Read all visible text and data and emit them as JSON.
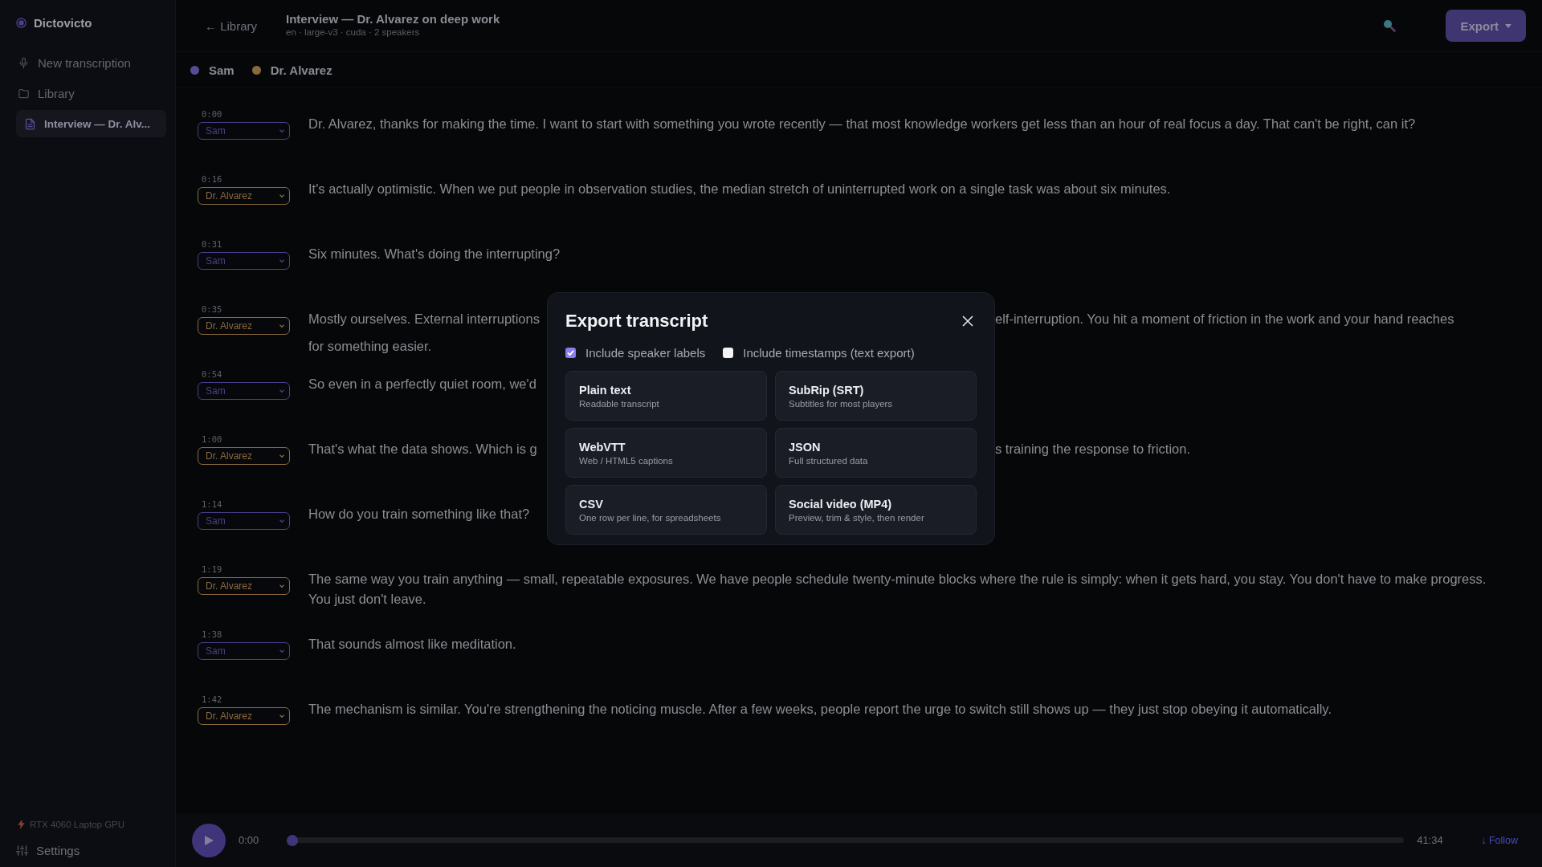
{
  "app": {
    "name": "Dictovicto"
  },
  "sidebar": {
    "items": [
      {
        "kind": "new",
        "label": "New transcription",
        "selected": false
      },
      {
        "kind": "library",
        "label": "Library",
        "selected": false
      },
      {
        "kind": "document",
        "label": "Interview — Dr. Alv...",
        "selected": true
      }
    ],
    "gpu": "RTX 4060 Laptop GPU",
    "settings": "Settings"
  },
  "header": {
    "back": "← Library",
    "title": "Interview — Dr. Alvarez on deep work",
    "meta": "en · large-v3 · cuda · 2 speakers",
    "export": "Export"
  },
  "speakers": [
    {
      "name": "Sam",
      "color": "#574b94"
    },
    {
      "name": "Dr. Alvarez",
      "color": "#8a6a3c"
    }
  ],
  "rows": [
    {
      "kind": "full",
      "time": "0:00",
      "speaker": "Sam",
      "color": "#4a3f8c",
      "text": "Dr. Alvarez, thanks for making the time. I want to start with something you wrote recently — that most knowledge workers get less than an hour of real focus a day. That can't be right, can it?"
    },
    {
      "kind": "full",
      "time": "0:16",
      "speaker": "Dr. Alvarez",
      "color": "#8a6a3c",
      "text": "It's actually optimistic. When we put people in observation studies, the median stretch of uninterrupted work on a single task was about six minutes."
    },
    {
      "kind": "full",
      "time": "0:31",
      "speaker": "Sam",
      "color": "#4a3f8c",
      "text": "Six minutes. What's doing the interrupting?"
    },
    {
      "kind": "covered",
      "time": "0:35",
      "speaker": "Dr. Alvarez",
      "color": "#8a6a3c",
      "left": "Mostly ourselves. External interruptions",
      "right": "elf-interruption. You hit a moment of friction in the work and your hand reaches",
      "more": "for something easier."
    },
    {
      "kind": "covered",
      "time": "0:54",
      "speaker": "Sam",
      "color": "#4a3f8c",
      "left": "So even in a perfectly quiet room, we'd"
    },
    {
      "kind": "covered",
      "time": "1:00",
      "speaker": "Dr. Alvarez",
      "color": "#8a6a3c",
      "left": "That's what the data shows. Which is g",
      "right": "s training the response to friction."
    },
    {
      "kind": "full",
      "time": "1:14",
      "speaker": "Sam",
      "color": "#4a3f8c",
      "text": "How do you train something like that?"
    },
    {
      "kind": "full",
      "time": "1:19",
      "speaker": "Dr. Alvarez",
      "color": "#8a6a3c",
      "text": "The same way you train anything — small, repeatable exposures. We have people schedule twenty-minute blocks where the rule is simply: when it gets hard, you stay. You don't have to make progress. You just don't leave."
    },
    {
      "kind": "full",
      "time": "1:38",
      "speaker": "Sam",
      "color": "#4a3f8c",
      "text": "That sounds almost like meditation."
    },
    {
      "kind": "full",
      "time": "1:42",
      "speaker": "Dr. Alvarez",
      "color": "#8a6a3c",
      "text": "The mechanism is similar. You're strengthening the noticing muscle. After a few weeks, people report the urge to switch still shows up — they just stop obeying it automatically."
    }
  ],
  "player": {
    "elapsed": "0:00",
    "level": 0,
    "duration": "41:34",
    "follow": "↓ Follow"
  },
  "dialog": {
    "title": "Export transcript",
    "options": [
      {
        "label": "Include speaker labels",
        "checked": true
      },
      {
        "label": "Include timestamps (text export)",
        "checked": false
      }
    ],
    "formats": [
      {
        "title": "Plain text",
        "description": "Readable transcript"
      },
      {
        "title": "SubRip (SRT)",
        "description": "Subtitles for most players"
      },
      {
        "title": "WebVTT",
        "description": "Web / HTML5 captions"
      },
      {
        "title": "JSON",
        "description": "Full structured data"
      },
      {
        "title": "CSV",
        "description": "One row per line, for spreadsheets"
      },
      {
        "title": "Social video (MP4)",
        "description": "Preview, trim & style, then render"
      }
    ]
  }
}
